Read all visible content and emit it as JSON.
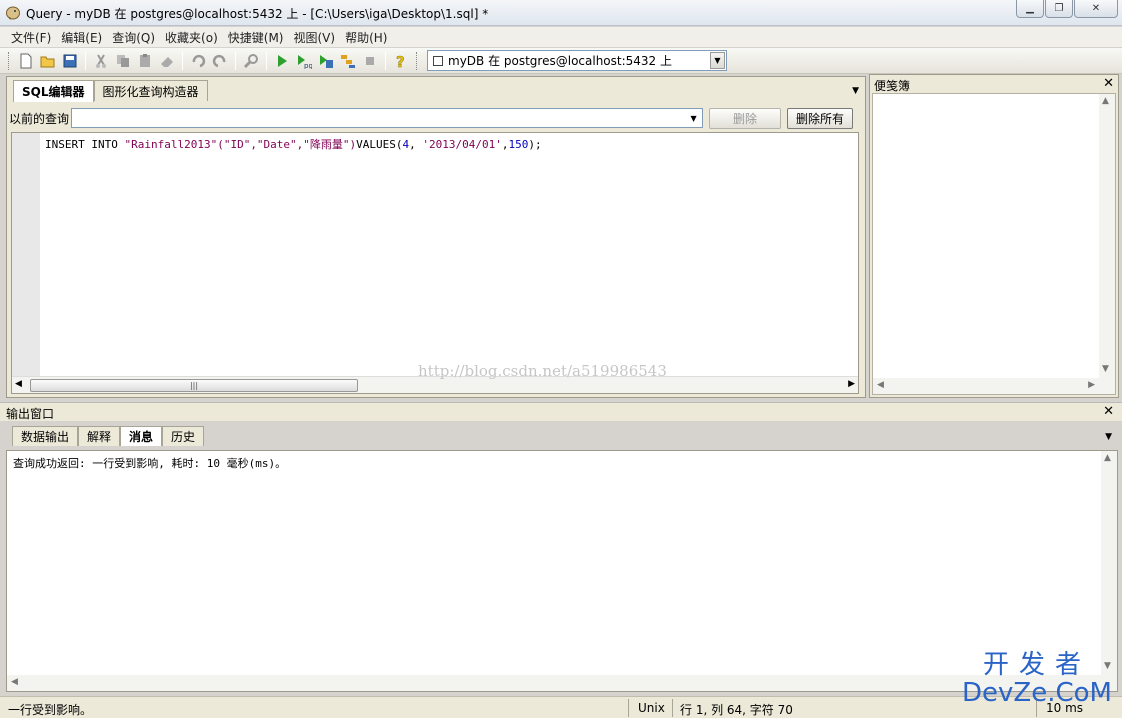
{
  "window": {
    "title": "Query - myDB 在  postgres@localhost:5432 上 - [C:\\Users\\iga\\Desktop\\1.sql] *",
    "controls": [
      "minimize",
      "maximize",
      "close"
    ]
  },
  "menu": [
    "文件(F)",
    "编辑(E)",
    "查询(Q)",
    "收藏夹(o)",
    "快捷键(M)",
    "视图(V)",
    "帮助(H)"
  ],
  "toolbar": {
    "buttons": [
      "new-icon",
      "open-icon",
      "save-icon",
      "cut-icon",
      "copy-icon",
      "paste-icon",
      "clear-icon",
      "undo-icon",
      "redo-icon",
      "find-icon",
      "execute-icon",
      "execute-pgscript-icon",
      "execute-to-file-icon",
      "explain-icon",
      "stop-icon",
      "help-icon"
    ],
    "connection": "myDB 在  postgres@localhost:5432 上"
  },
  "editor": {
    "tabs": [
      "SQL编辑器",
      "图形化查询构造器"
    ],
    "active_tab": "SQL编辑器",
    "previous_label": "以前的查询",
    "previous_value": "",
    "delete_label": "删除",
    "delete_all_label": "删除所有",
    "code": {
      "part1": "INSERT INTO ",
      "part2": "\"Rainfall2013\"(\"ID\",\"Date\",\"降雨量\")",
      "part3": "VALUES(",
      "part4": "4",
      "part5": ", ",
      "part6": "'2013/04/01'",
      "part7": ",",
      "part8": "150",
      "part9": ");"
    }
  },
  "watermark": "http://blog.csdn.net/a519986543",
  "notes": {
    "title": "便笺簿"
  },
  "output": {
    "title": "输出窗口",
    "tabs": [
      "数据输出",
      "解释",
      "消息",
      "历史"
    ],
    "active_tab": "消息",
    "message": "查询成功返回: 一行受到影响, 耗时: 10 毫秒(ms)。"
  },
  "status": {
    "message": "一行受到影响。",
    "line_ending": "Unix",
    "position": "行 1, 列 64, 字符 70",
    "time": "10 ms"
  },
  "brand": {
    "cn": "开发者",
    "en": "DevZe.CoM"
  }
}
